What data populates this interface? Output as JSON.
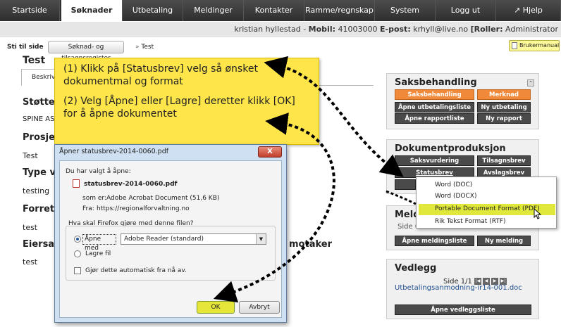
{
  "nav": {
    "tabs": [
      {
        "label": "Startside"
      },
      {
        "label": "Søknader"
      },
      {
        "label": "Utbetaling"
      },
      {
        "label": "Meldinger"
      },
      {
        "label": "Kontakter"
      },
      {
        "label": "Ramme/regnskap"
      },
      {
        "label": "System"
      },
      {
        "label": "Logg ut"
      },
      {
        "label": "Hjelp"
      }
    ]
  },
  "userbar": {
    "name": "kristian hyllestad",
    "mobile_label": "Mobil:",
    "mobile": "41003000",
    "email_label": "E-post:",
    "email": "krhyll@live.no",
    "roles_label": "[Roller:",
    "roles": "Administrator"
  },
  "breadcrumb": {
    "start": "Sti til side",
    "sep": "»",
    "register": "Søknad- og tilsagnsregister",
    "current": "Test"
  },
  "brukermanual": "Brukermanual",
  "page": {
    "title": "Test",
    "tab": "Beskrive",
    "sections": [
      {
        "heading": "Støtte",
        "value": "SPINE AS"
      },
      {
        "heading": "Prosjektnavn",
        "value": "Test"
      },
      {
        "heading": "Type v",
        "value": "testing"
      },
      {
        "heading": "Forret",
        "value": "test"
      },
      {
        "heading": "Eiersa",
        "value": "test"
      }
    ],
    "hidden_heading_tail": "motaker"
  },
  "callout": {
    "step1": "(1) Klikk på [Statusbrev] velg så ønsket dokumentmal og format",
    "step2": "(2) Velg [Åpne] eller [Lagre] deretter klikk [OK] for å åpne dokumentet"
  },
  "dialog": {
    "title": "Åpner statusbrev-2014-0060.pdf",
    "close": "X",
    "intro": "Du har valgt å åpne:",
    "filename": "statusbrev-2014-0060.pdf",
    "type_label": "som er:",
    "type_value": "Adobe Acrobat Document (51,6 KB)",
    "from_label": "Fra:",
    "from_value": "https://regionalforvaltning.no",
    "question": "Hva skal Firefox gjøre med denne filen?",
    "open_with": "Åpne med",
    "app": "Adobe Reader  (standard)",
    "save": "Lagre fil",
    "auto": "Gjør dette automatisk fra nå av.",
    "ok": "OK",
    "cancel": "Avbryt"
  },
  "saksbehandling": {
    "title": "Saksbehandling",
    "buttons": [
      "Saksbehandling",
      "Merknad",
      "Åpne utbetalingsliste",
      "Ny utbetaling",
      "Åpne rapportliste",
      "Ny rapport"
    ]
  },
  "dokumentproduksjon": {
    "title": "Dokumentproduksjon",
    "buttons": [
      "Saksvurdering",
      "Tilsagnsbrev",
      "Statusbrev",
      "Avslagsbrev"
    ]
  },
  "popup": {
    "items": [
      "Word (DOC)",
      "Word (DOCX)",
      "Portable Document Format (PDF)",
      "Rik Tekst Format (RTF)"
    ]
  },
  "meldinger": {
    "title": "Meld",
    "side": "Side 0",
    "buttons": [
      "Åpne meldingsliste",
      "Ny melding"
    ]
  },
  "vedlegg": {
    "title": "Vedlegg",
    "pager": "Side 1/1",
    "link": "Utbetalingsanmodning-ir14-001.doc",
    "button": "Åpne vedleggsliste"
  },
  "colors": {
    "accent": "#f08a3a",
    "callout": "#fde54a",
    "highlight": "#dfe83b",
    "dark": "#4a4a4a"
  }
}
